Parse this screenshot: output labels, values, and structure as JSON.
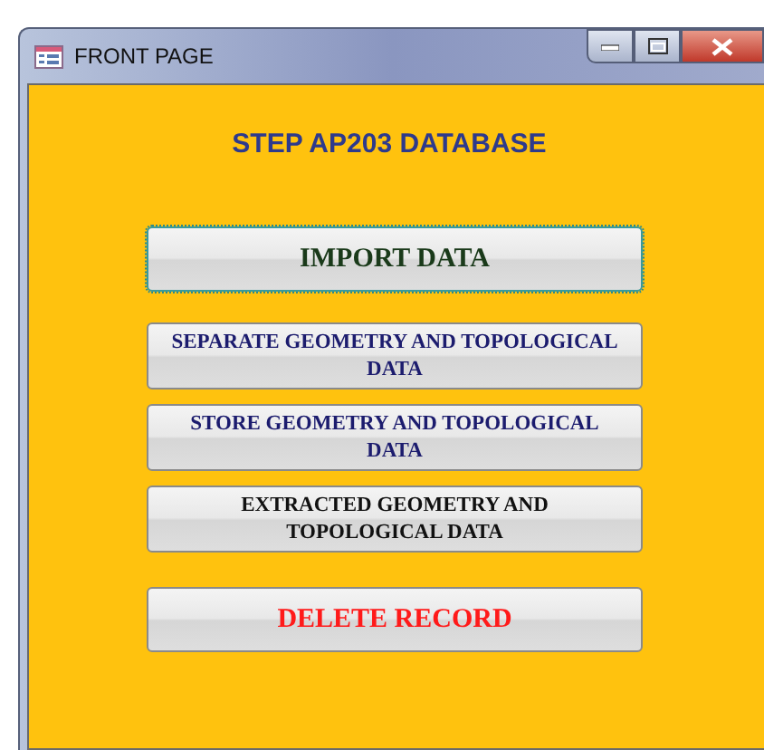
{
  "window": {
    "title": "FRONT PAGE"
  },
  "heading": "STEP AP203 DATABASE",
  "buttons": [
    {
      "label": "IMPORT DATA",
      "color": "#1a3a1a",
      "focused": true,
      "kind": "large"
    },
    {
      "label": "SEPARATE GEOMETRY AND TOPOLOGICAL DATA",
      "color": "#1c1c6e",
      "focused": false,
      "kind": "small"
    },
    {
      "label": "STORE GEOMETRY AND TOPOLOGICAL DATA",
      "color": "#1c1c6e",
      "focused": false,
      "kind": "small"
    },
    {
      "label": "EXTRACTED GEOMETRY AND TOPOLOGICAL DATA",
      "color": "#111111",
      "focused": false,
      "kind": "small"
    },
    {
      "label": "DELETE RECORD",
      "color": "#ff1a1a",
      "focused": false,
      "kind": "large"
    }
  ]
}
